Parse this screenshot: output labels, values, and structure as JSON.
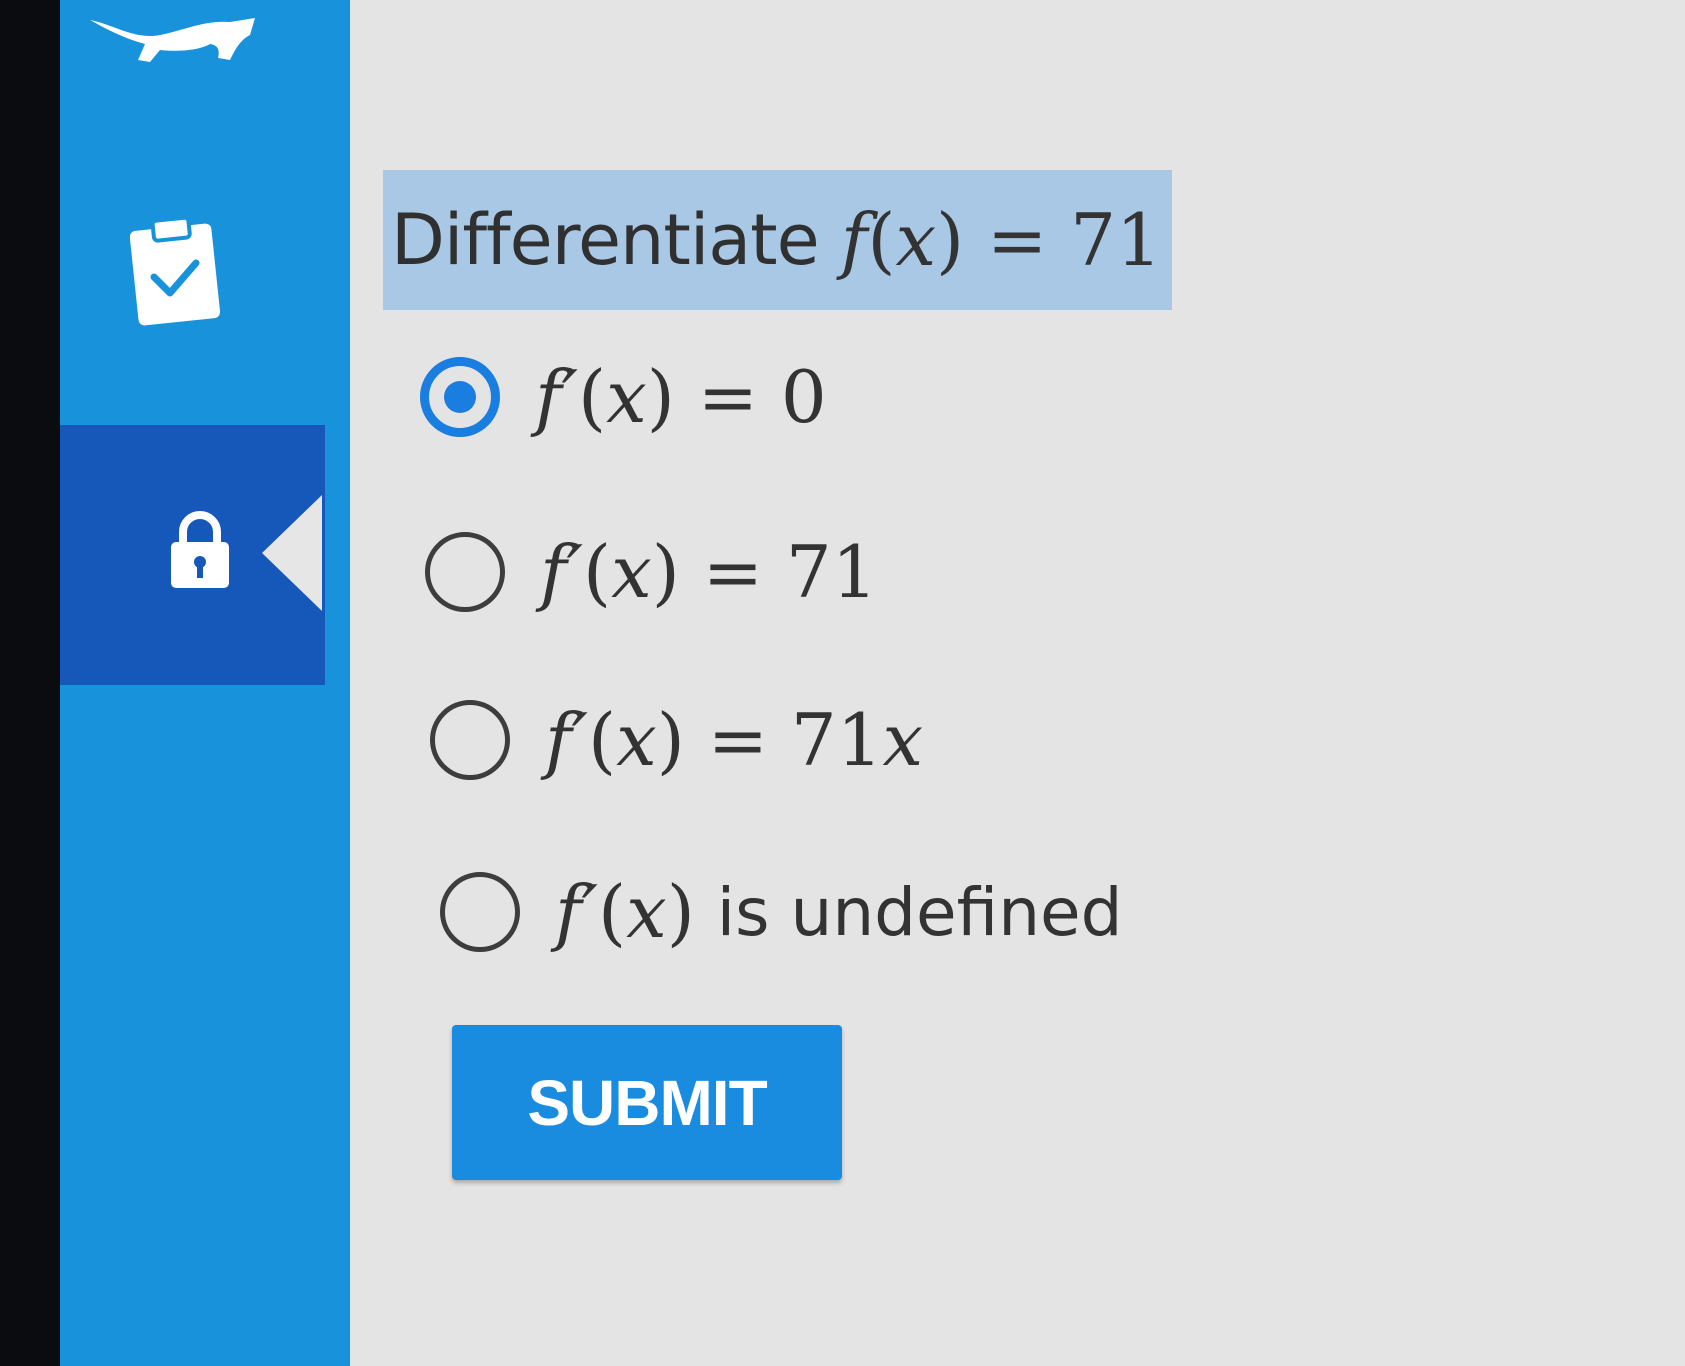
{
  "colors": {
    "sidebar": "#1792db",
    "sidebar_active": "#1558b9",
    "accent": "#1a7de0",
    "question_highlight": "#a9c8e6",
    "background": "#e4e4e4"
  },
  "sidebar": {
    "items": [
      {
        "icon": "logo-icon"
      },
      {
        "icon": "clipboard-check-icon"
      },
      {
        "icon": "lock-icon",
        "active": true
      }
    ]
  },
  "question": {
    "prompt": "Differentiate",
    "expression": {
      "fn": "f",
      "var": "x",
      "rhs": "71"
    }
  },
  "options": [
    {
      "fn": "f′",
      "var": "x",
      "relation": "=",
      "rhs": "0",
      "selected": true
    },
    {
      "fn": "f′",
      "var": "x",
      "relation": "=",
      "rhs": "71",
      "selected": false
    },
    {
      "fn": "f′",
      "var": "x",
      "relation": "=",
      "rhs_num": "71",
      "rhs_var": "x",
      "selected": false
    },
    {
      "fn": "f′",
      "var": "x",
      "text": "is undefined",
      "selected": false
    }
  ],
  "submit": {
    "label": "SUBMIT"
  }
}
